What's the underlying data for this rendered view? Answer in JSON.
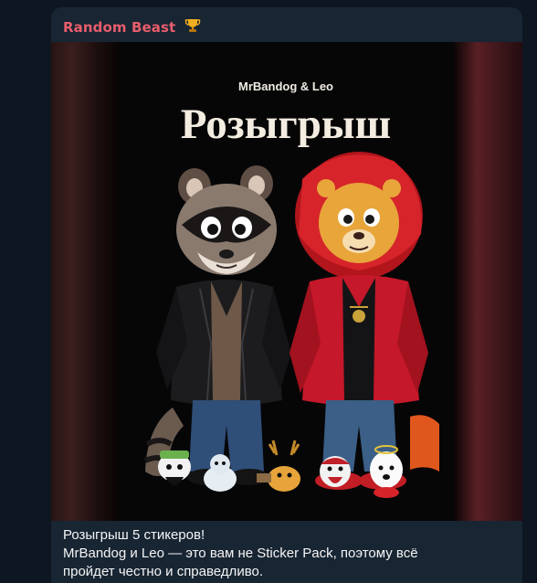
{
  "message": {
    "sender_name": "Random Beast",
    "sender_icon": "trophy-icon",
    "sender_color": "#e85d6c",
    "poster": {
      "top_text": "MrBandog & Leo",
      "headline": "Розыгрыш"
    },
    "caption_lines": [
      "Розыгрыш 5 стикеров!",
      "MrBandog и Leo — это вам не Sticker Pack, поэтому всё",
      "пройдет честно и справедливо."
    ]
  },
  "colors": {
    "background": "#0e1621",
    "bubble": "#182533",
    "text": "#f5f5f5"
  }
}
